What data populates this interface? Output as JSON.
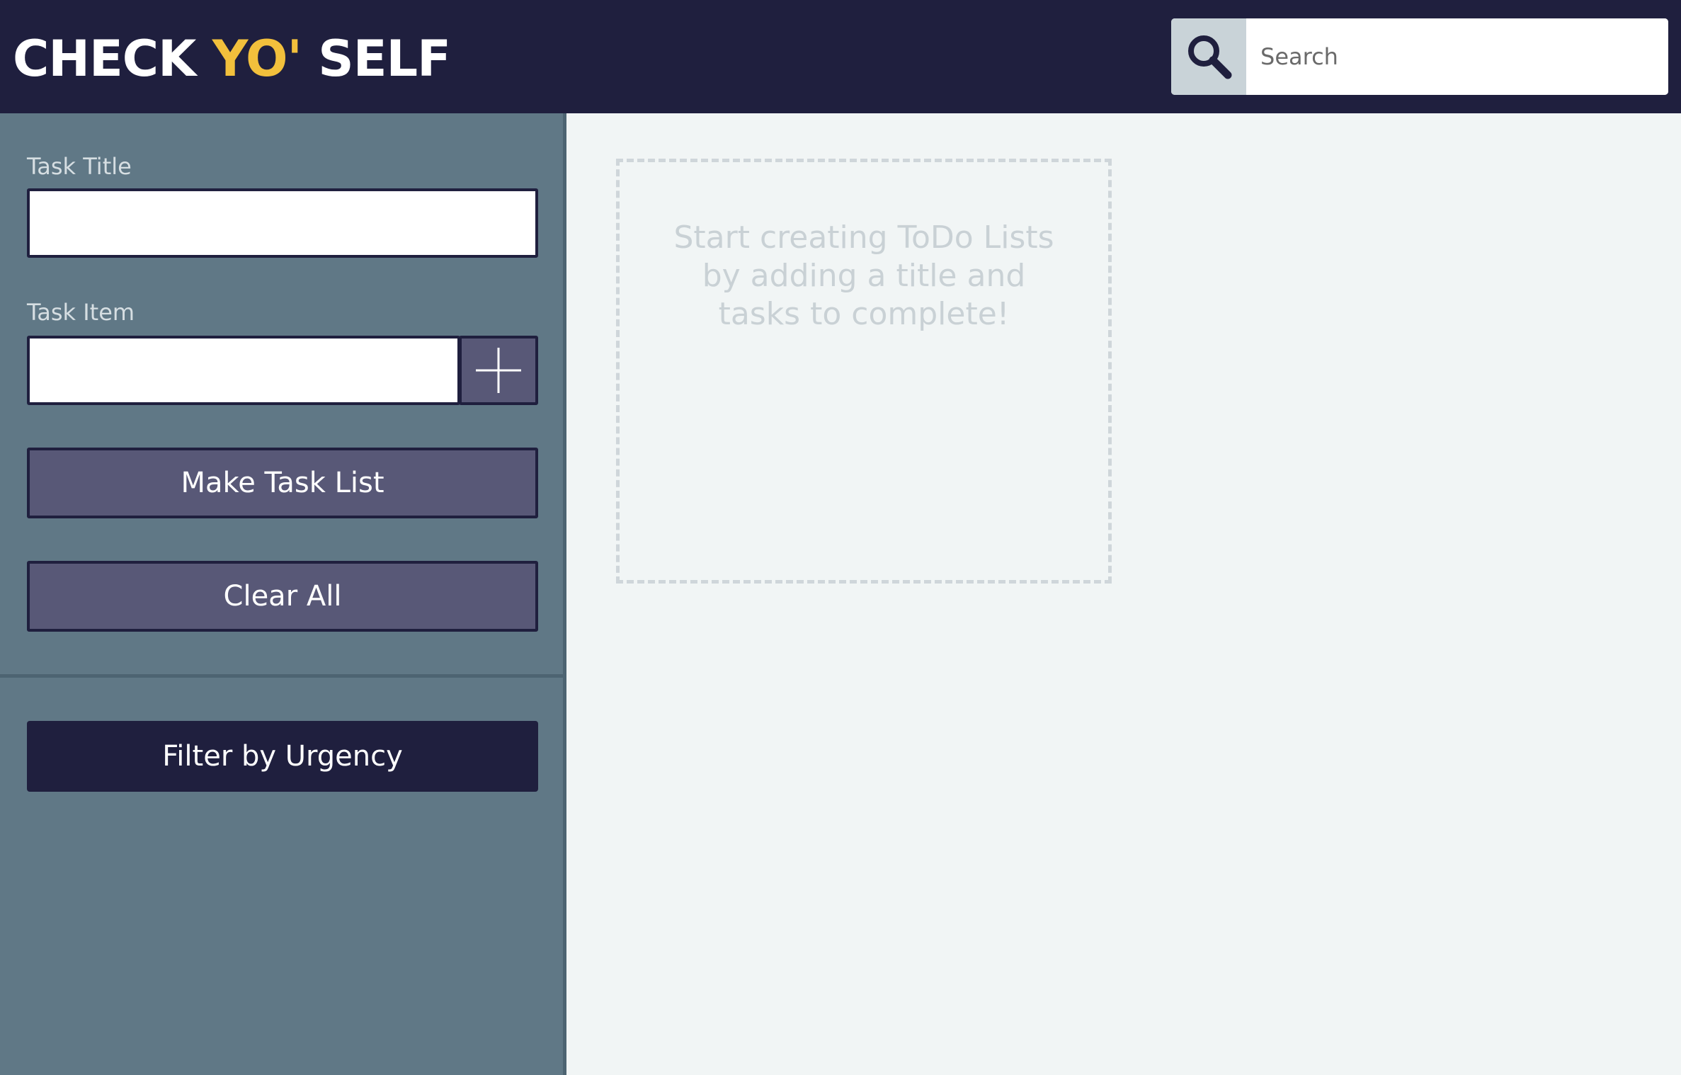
{
  "app": {
    "logo_part1": "CHECK ",
    "logo_part2": "YO'",
    "logo_part3": " SELF",
    "accent_color": "#f2c03c",
    "header_color": "#1f1f3e"
  },
  "search": {
    "placeholder": "Search",
    "icon": "search-icon"
  },
  "sidebar": {
    "task_title_label": "Task Title",
    "task_item_label": "Task Item",
    "add_item_icon": "plus-icon",
    "make_list_label": "Make Task List",
    "clear_all_label": "Clear All",
    "filter_label": "Filter by Urgency"
  },
  "main": {
    "empty_message": "Start creating ToDo Lists by adding a title and tasks to complete!"
  }
}
